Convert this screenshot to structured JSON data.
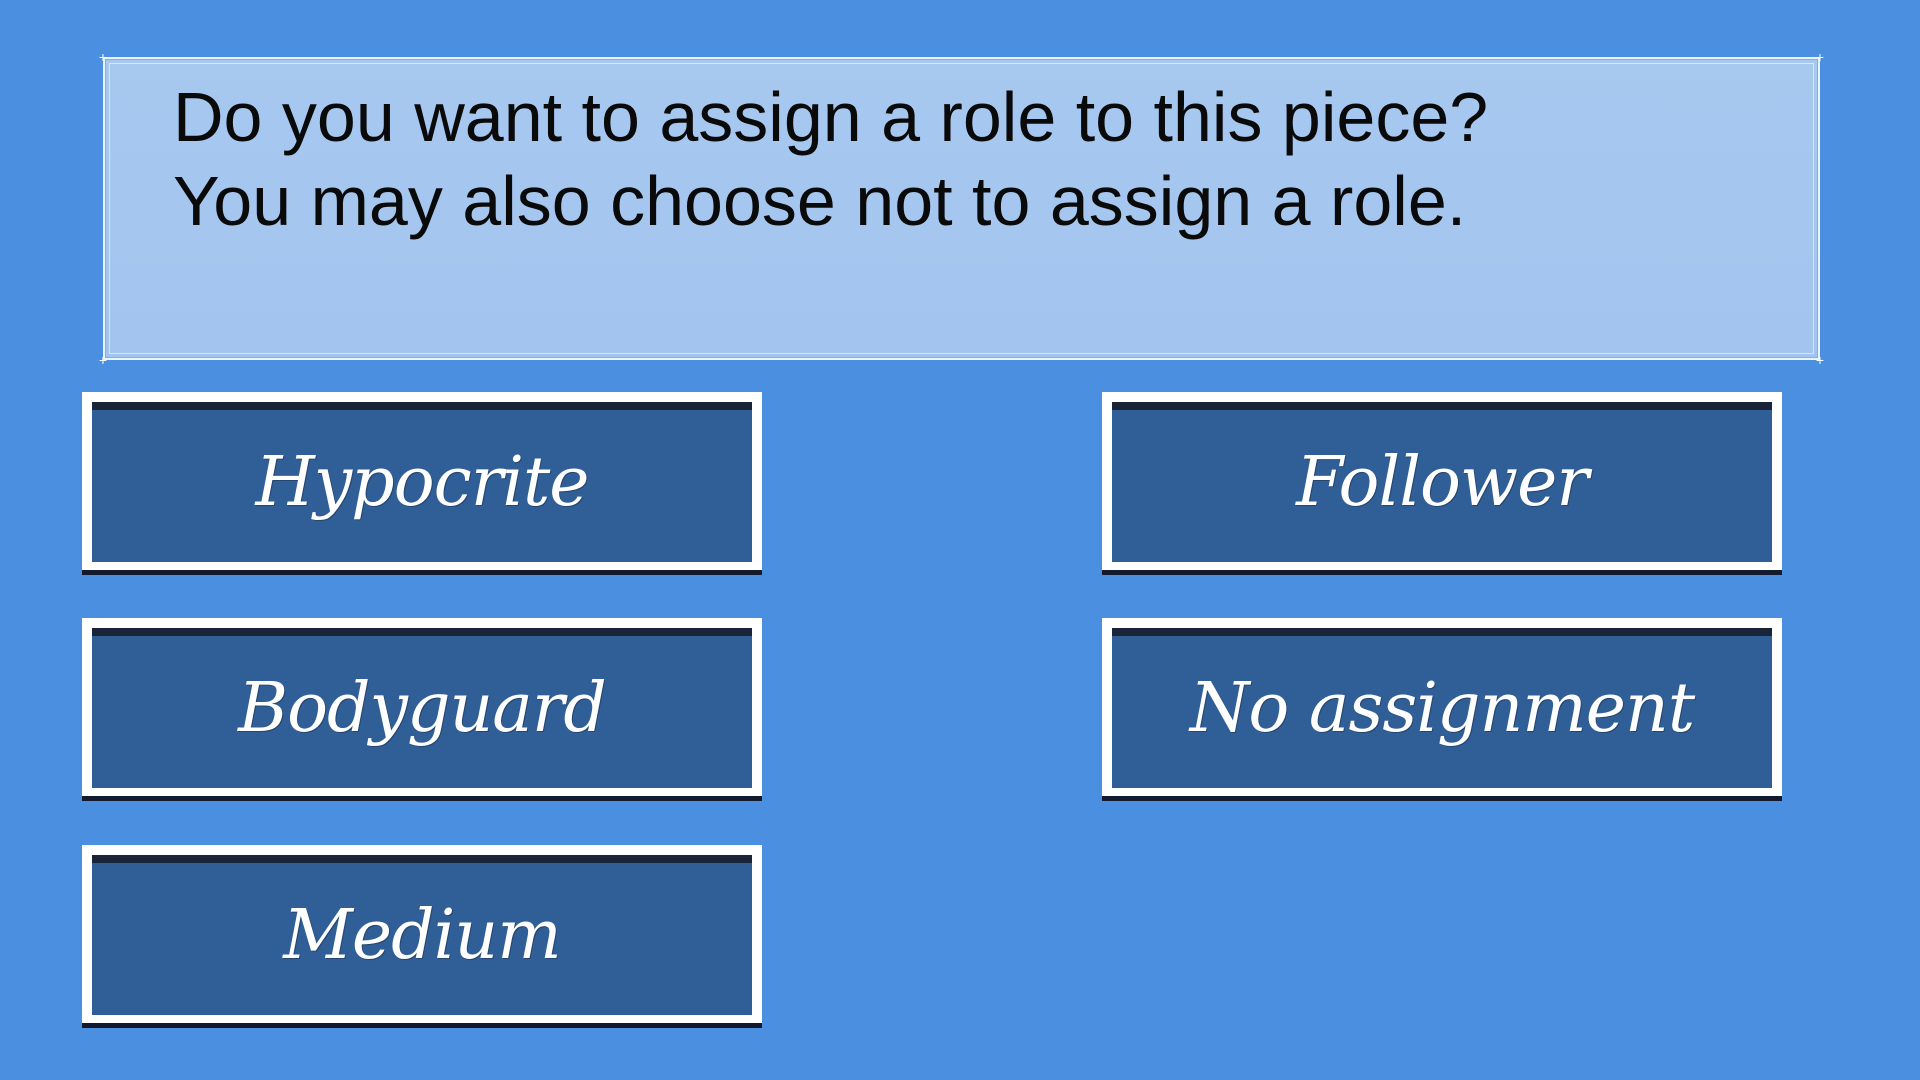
{
  "dialog": {
    "prompt_line1": "Do you want to assign a role to this piece?",
    "prompt_line2": "You may also choose not to assign a role."
  },
  "roles": [
    {
      "label": "Hypocrite"
    },
    {
      "label": "Follower"
    },
    {
      "label": "Bodyguard"
    },
    {
      "label": "No assignment"
    },
    {
      "label": "Medium"
    }
  ],
  "colors": {
    "background": "#4a8fe0",
    "dialog_fill": "#a4c6ef",
    "button_fill": "#305e96",
    "button_border": "#ffffff",
    "prompt_text": "#0a0a0a",
    "button_text": "#ffffff"
  }
}
